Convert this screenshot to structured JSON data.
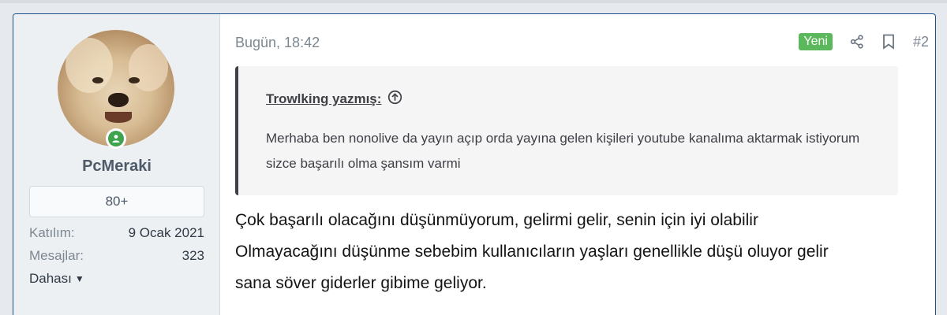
{
  "user": {
    "username": "PcMeraki",
    "banner": "80+",
    "stats": [
      {
        "label": "Katılım:",
        "value": "9 Ocak 2021"
      },
      {
        "label": "Mesajlar:",
        "value": "323"
      }
    ],
    "more_label": "Dahası"
  },
  "post": {
    "time": "Bugün, 18:42",
    "new_badge": "Yeni",
    "number": "#2",
    "quote": {
      "author": "Trowlking yazmış:",
      "text": "Merhaba ben nonolive da yayın açıp orda yayına gelen kişileri youtube kanalıma aktarmak istiyorum sizce başarılı olma şansım varmi"
    },
    "message_lines": [
      "Çok başarılı olacağını düşünmüyorum, gelirmi gelir, senin için iyi olabilir",
      "Olmayacağını düşünme sebebim kullanıcıların yaşları genellikle düşü oluyor gelir",
      "sana söver giderler gibime geliyor."
    ]
  },
  "colors": {
    "accent_border": "#1f4e8c",
    "online": "#3fa34d",
    "new_badge": "#5cb85c"
  }
}
